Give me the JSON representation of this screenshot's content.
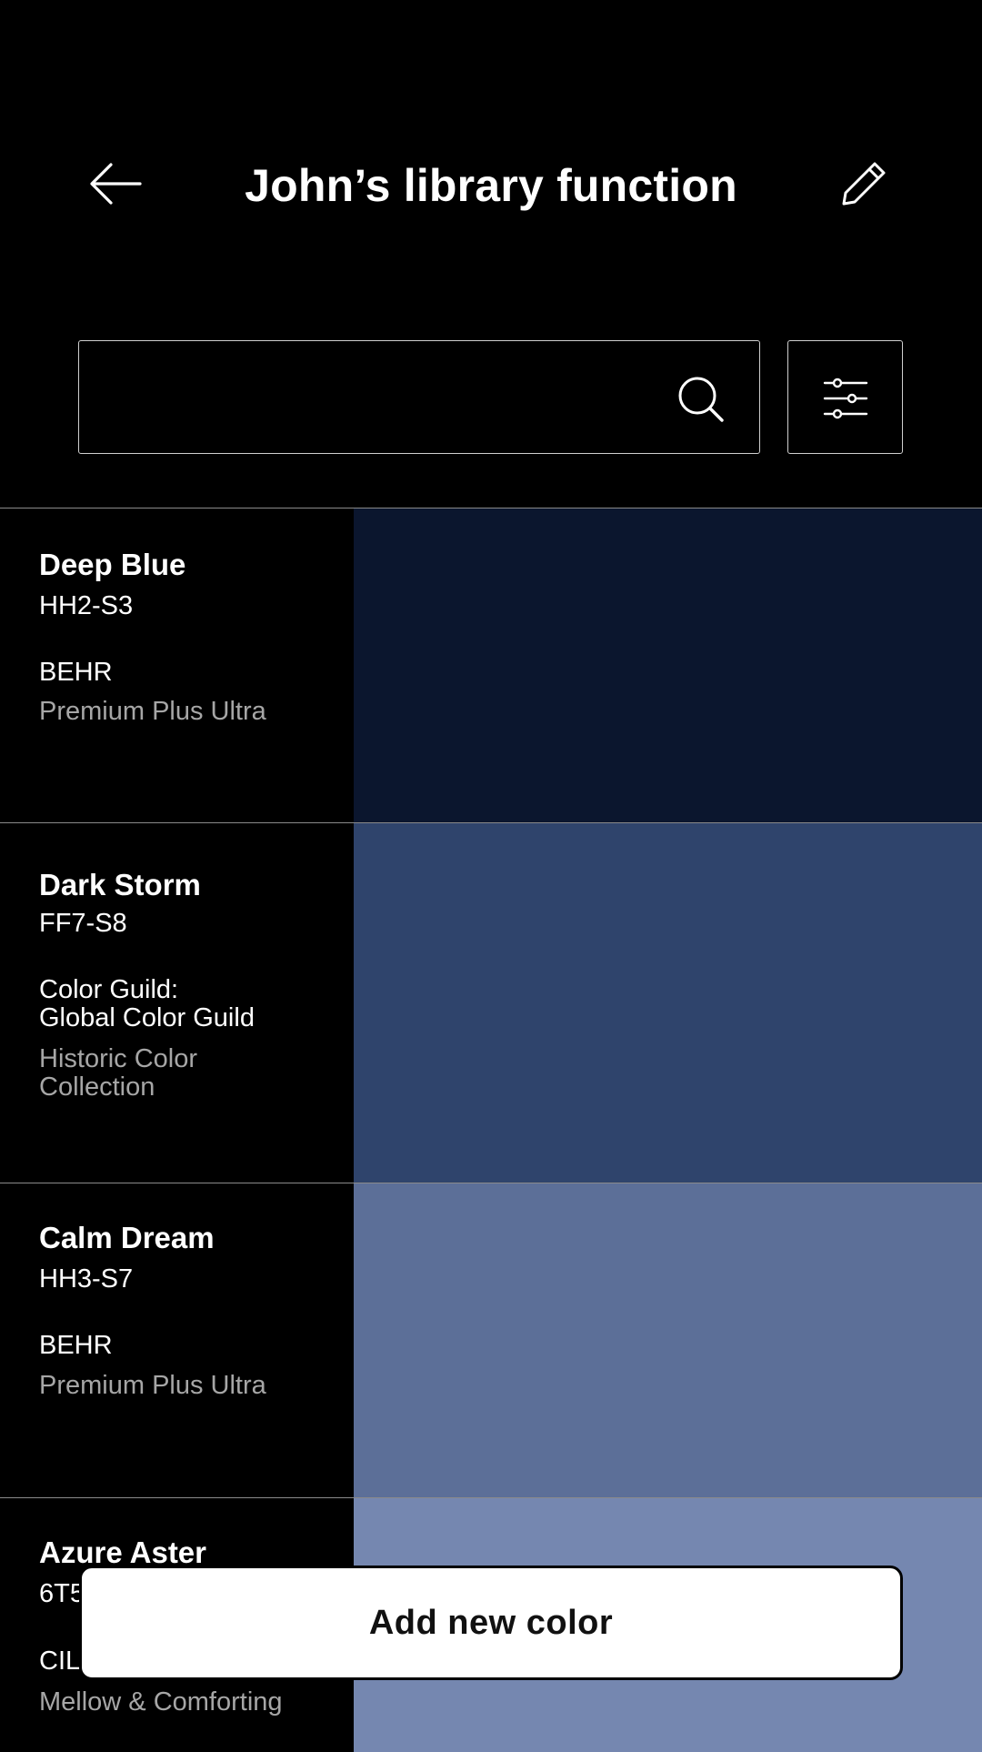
{
  "header": {
    "title": "John’s library function",
    "back_icon": "arrow-left-icon",
    "edit_icon": "pencil-icon"
  },
  "search": {
    "value": "",
    "placeholder": "",
    "icon": "search-icon"
  },
  "filter": {
    "icon": "sliders-icon"
  },
  "colors": [
    {
      "name": "Deep Blue",
      "code": "HH2-S3",
      "brand": "BEHR",
      "collection": "Premium Plus Ultra",
      "swatch": "#0b162e"
    },
    {
      "name": "Dark Storm",
      "code": "FF7-S8",
      "brand": "Color Guild:\nGlobal Color Guild",
      "collection": "Historic Color\nCollection",
      "swatch": "#2f446c"
    },
    {
      "name": "Calm Dream",
      "code": "HH3-S7",
      "brand": "BEHR",
      "collection": "Premium Plus Ultra",
      "swatch": "#5c6f98"
    },
    {
      "name": "Azure Aster",
      "code": "6T5",
      "brand": "CIL",
      "collection": "Mellow & Comforting",
      "swatch": "#7587b0"
    }
  ],
  "add_button": {
    "label": "Add new color"
  },
  "theme": {
    "background": "#000000",
    "text": "#ffffff",
    "muted_text": "#a6a6a6",
    "divider": "#8a8a8a"
  }
}
